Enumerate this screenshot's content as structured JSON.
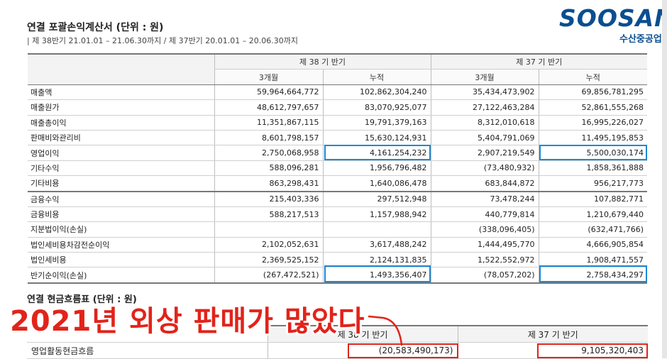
{
  "header": {
    "title": "연결 포괄손익계산서 (단위 : 원)",
    "subtitle": "| 제 38반기 21.01.01 – 21.06.30까지 / 제 37반기 20.01.01 – 20.06.30까지"
  },
  "logo": {
    "main": "SOOSAN",
    "sub": "수산중공업"
  },
  "income_table": {
    "period_headers": [
      "제 38 기 반기",
      "제 37 기 반기"
    ],
    "sub_headers": [
      "3개월",
      "누적",
      "3개월",
      "누적"
    ],
    "rows": [
      {
        "label": "매출액",
        "values": [
          "59,964,664,772",
          "102,862,304,240",
          "35,434,473,902",
          "69,856,781,295"
        ]
      },
      {
        "label": "매출원가",
        "values": [
          "48,612,797,657",
          "83,070,925,077",
          "27,122,463,284",
          "52,861,555,268"
        ]
      },
      {
        "label": "매출총이익",
        "values": [
          "11,351,867,115",
          "19,791,379,163",
          "8,312,010,618",
          "16,995,226,027"
        ]
      },
      {
        "label": "판매비와관리비",
        "values": [
          "8,601,798,157",
          "15,630,124,931",
          "5,404,791,069",
          "11,495,195,853"
        ]
      },
      {
        "label": "영업이익",
        "values": [
          "2,750,068,958",
          "4,161,254,232",
          "2,907,219,549",
          "5,500,030,174"
        ]
      },
      {
        "label": "기타수익",
        "values": [
          "588,096,281",
          "1,956,796,482",
          "(73,480,932)",
          "1,858,361,888"
        ]
      },
      {
        "label": "기타비용",
        "values": [
          "863,298,431",
          "1,640,086,478",
          "683,844,872",
          "956,217,773"
        ]
      },
      {
        "label": "금융수익",
        "values": [
          "215,403,336",
          "297,512,948",
          "73,478,244",
          "107,882,771"
        ]
      },
      {
        "label": "금융비용",
        "values": [
          "588,217,513",
          "1,157,988,942",
          "440,779,814",
          "1,210,679,440"
        ]
      },
      {
        "label": "지분법이익(손실)",
        "values": [
          "",
          "",
          "(338,096,405)",
          "(632,471,766)"
        ]
      },
      {
        "label": "법인세비용차감전순이익",
        "values": [
          "2,102,052,631",
          "3,617,488,242",
          "1,444,495,770",
          "4,666,905,854"
        ]
      },
      {
        "label": "법인세비용",
        "values": [
          "2,369,525,152",
          "2,124,131,835",
          "1,522,552,972",
          "1,908,471,557"
        ]
      },
      {
        "label": "반기순이익(손실)",
        "values": [
          "(267,472,521)",
          "1,493,356,407",
          "(78,057,202)",
          "2,758,434,297"
        ]
      }
    ]
  },
  "cashflow": {
    "title": "연결 현금흐름표 (단위 : 원)",
    "headers": [
      "제 38 기 반기",
      "제 37 기 반기"
    ],
    "row": {
      "label": "영업활동현금흐름",
      "values": [
        "(20,583,490,173)",
        "9,105,320,403"
      ]
    }
  },
  "overlay_caption": "2021년 외상 판매가 많았다",
  "colors": {
    "highlight_blue": "#1e88d6",
    "highlight_red": "#e2231a",
    "brand": "#0b4e91"
  }
}
